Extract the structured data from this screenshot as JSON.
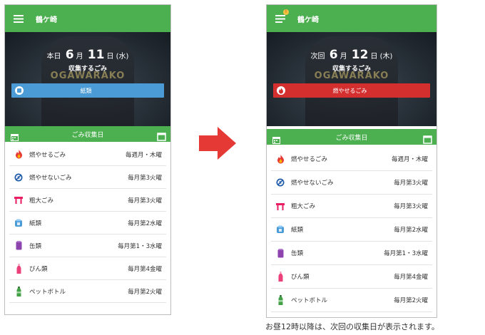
{
  "left": {
    "title": "鶴ケ崎",
    "day_prefix": "本日",
    "month": "6",
    "month_unit": "月",
    "day": "11",
    "day_unit": "日",
    "weekday": "(水)",
    "sub": "収集するごみ",
    "type_label": "紙類",
    "type_color": "#4a9bd6",
    "calendar_header": "ごみ収集日"
  },
  "right": {
    "title": "鶴ケ崎",
    "day_prefix": "次回",
    "month": "6",
    "month_unit": "月",
    "day": "12",
    "day_unit": "日",
    "weekday": "(木)",
    "sub": "収集するごみ",
    "type_label": "燃やせるごみ",
    "type_color": "#d32f2f",
    "calendar_header": "ごみ収集日"
  },
  "shirt_text": "OGAWARAKO",
  "items": [
    {
      "name": "燃やせるごみ",
      "schedule": "毎週月・木曜",
      "icon": "flame-icon"
    },
    {
      "name": "燃やせないごみ",
      "schedule": "毎月第3火曜",
      "icon": "non-burnable-icon"
    },
    {
      "name": "粗大ごみ",
      "schedule": "毎月第3火曜",
      "icon": "table-icon"
    },
    {
      "name": "紙類",
      "schedule": "毎月第2水曜",
      "icon": "paper-icon"
    },
    {
      "name": "缶類",
      "schedule": "毎月第1・3水曜",
      "icon": "can-icon"
    },
    {
      "name": "びん類",
      "schedule": "毎月第4金曜",
      "icon": "bottle-icon"
    },
    {
      "name": "ペットボトル",
      "schedule": "毎月第2火曜",
      "icon": "pet-bottle-icon"
    }
  ],
  "caption": "お昼12時以降は、次回の収集日が表示されます。",
  "colors": {
    "green": "#4caf50",
    "arrow": "#e53935"
  }
}
